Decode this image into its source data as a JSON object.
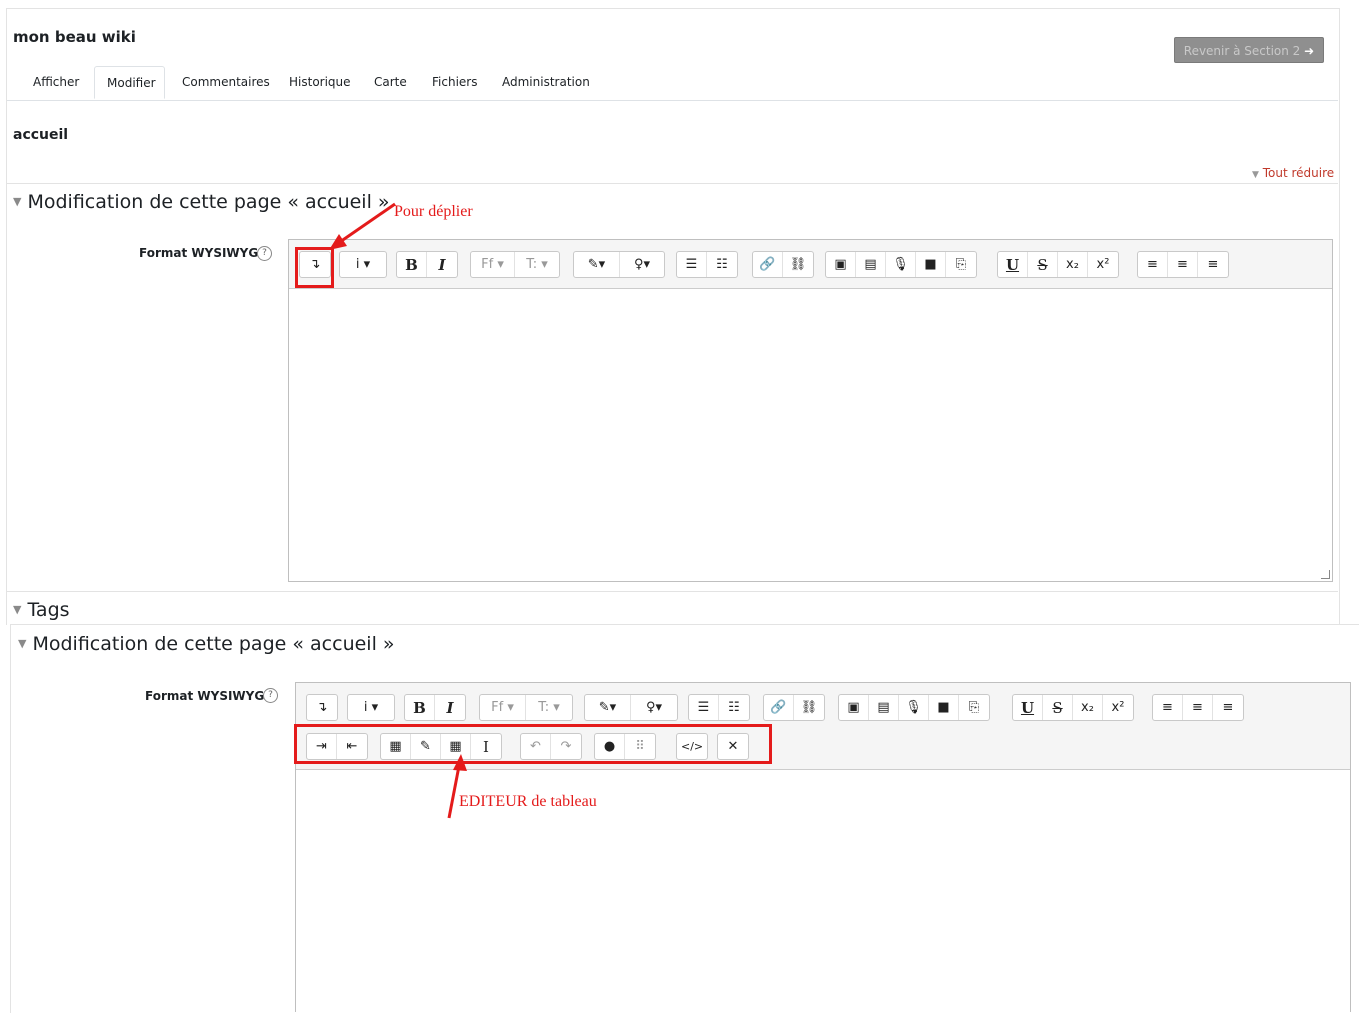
{
  "header": {
    "wiki_title": "mon beau wiki",
    "return_button": "Revenir à Section 2"
  },
  "tabs": [
    "Afficher",
    "Modifier",
    "Commentaires",
    "Historique",
    "Carte",
    "Fichiers",
    "Administration"
  ],
  "active_tab": "Modifier",
  "page_name": "accueil",
  "collapse_all": "Tout réduire",
  "section1": {
    "legend": "Modification de cette page « accueil »",
    "format_label": "Format WYSIWYG",
    "annotation": "Pour déplier"
  },
  "tags_legend": "Tags",
  "section2": {
    "legend": "Modification de cette page « accueil »",
    "format_label": "Format WYSIWYG",
    "annotation": "EDITEUR de tableau"
  },
  "toolbar": {
    "expand": "↴",
    "info": "i ▾",
    "bold": "B",
    "italic": "I",
    "font_family": "Ff ▾",
    "font_size": "T: ▾",
    "color": "✎▾",
    "highlight": "♀▾",
    "ul": "☰",
    "ol": "☷",
    "link": "🔗",
    "unlink": "⛓",
    "image": "▣",
    "media": "▤",
    "audio": "🎙",
    "video": "■",
    "manage": "⎘",
    "underline": "U",
    "strike": "S",
    "sub": "x₂",
    "sup": "x²",
    "align_left": "≡",
    "align_center": "≡",
    "align_right": "≡",
    "indent": "⇥",
    "outdent": "⇤",
    "calc": "▦",
    "edit": "✎",
    "table": "▦",
    "cursor": "I",
    "undo": "↶",
    "redo": "↷",
    "accessibility": "●",
    "screenreader": "⠿",
    "html": "</>",
    "fullscreen": "✕"
  },
  "colors": {
    "accent_red": "#e41b1b",
    "link_red": "#c0392b",
    "button_grey": "#8f8f8f"
  }
}
